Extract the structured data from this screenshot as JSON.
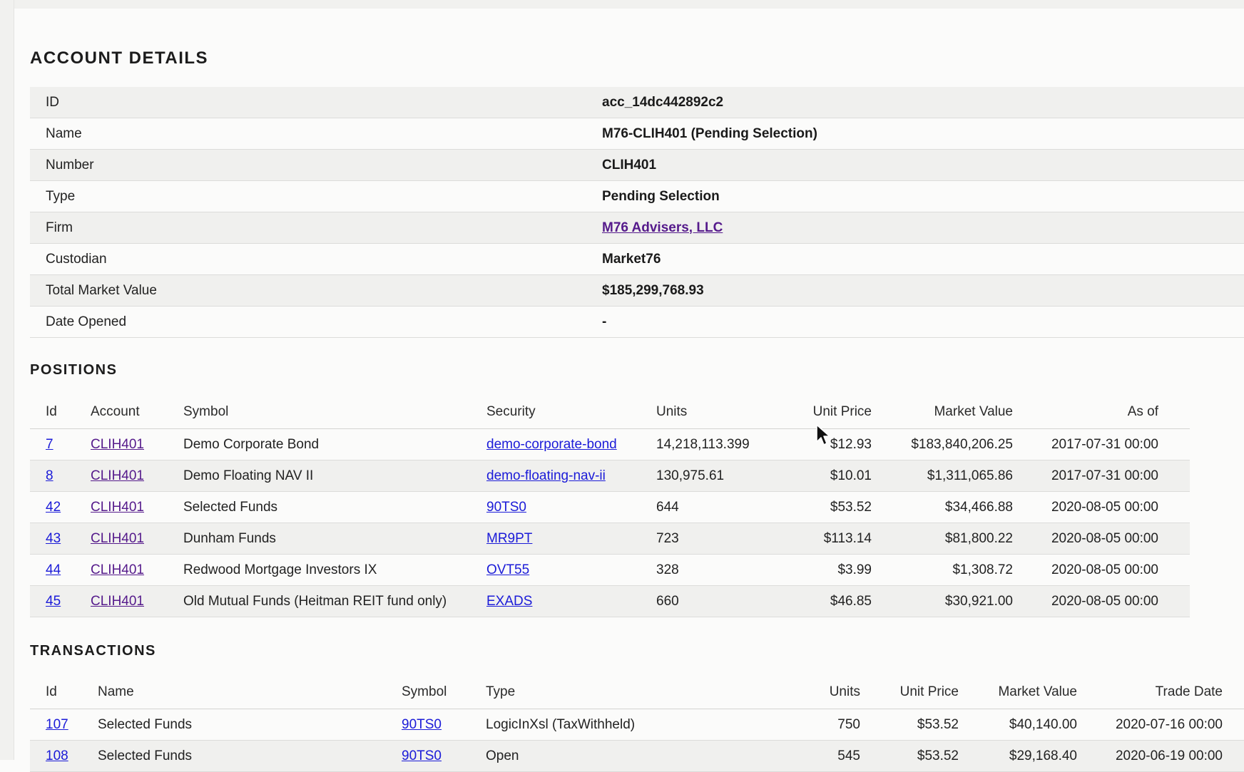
{
  "account_details": {
    "title": "ACCOUNT DETAILS",
    "rows": [
      {
        "label": "ID",
        "value": "acc_14dc442892c2"
      },
      {
        "label": "Name",
        "value": "M76-CLIH401 (Pending Selection)"
      },
      {
        "label": "Number",
        "value": "CLIH401"
      },
      {
        "label": "Type",
        "value": "Pending Selection"
      },
      {
        "label": "Firm",
        "value": "M76 Advisers, LLC"
      },
      {
        "label": "Custodian",
        "value": "Market76"
      },
      {
        "label": "Total Market Value",
        "value": "$185,299,768.93"
      },
      {
        "label": "Date Opened",
        "value": "-"
      }
    ]
  },
  "positions": {
    "title": "POSITIONS",
    "headers": [
      "Id",
      "Account",
      "Symbol",
      "Security",
      "Units",
      "Unit Price",
      "Market Value",
      "As of"
    ],
    "rows": [
      [
        "7",
        "CLIH401",
        "Demo Corporate Bond",
        "demo-corporate-bond",
        "14,218,113.399",
        "$12.93",
        "$183,840,206.25",
        "2017-07-31 00:00"
      ],
      [
        "8",
        "CLIH401",
        "Demo Floating NAV II",
        "demo-floating-nav-ii",
        "130,975.61",
        "$10.01",
        "$1,311,065.86",
        "2017-07-31 00:00"
      ],
      [
        "42",
        "CLIH401",
        "Selected Funds",
        "90TS0",
        "644",
        "$53.52",
        "$34,466.88",
        "2020-08-05 00:00"
      ],
      [
        "43",
        "CLIH401",
        "Dunham Funds",
        "MR9PT",
        "723",
        "$113.14",
        "$81,800.22",
        "2020-08-05 00:00"
      ],
      [
        "44",
        "CLIH401",
        "Redwood Mortgage Investors IX",
        "OVT55",
        "328",
        "$3.99",
        "$1,308.72",
        "2020-08-05 00:00"
      ],
      [
        "45",
        "CLIH401",
        "Old Mutual Funds (Heitman REIT fund only)",
        "EXADS",
        "660",
        "$46.85",
        "$30,921.00",
        "2020-08-05 00:00"
      ]
    ]
  },
  "transactions": {
    "title": "TRANSACTIONS",
    "headers": [
      "Id",
      "Name",
      "Symbol",
      "Type",
      "Units",
      "Unit Price",
      "Market Value",
      "Trade Date"
    ],
    "rows": [
      [
        "107",
        "Selected Funds",
        "90TS0",
        "LogicInXsl (TaxWithheld)",
        "750",
        "$53.52",
        "$40,140.00",
        "2020-07-16 00:00"
      ],
      [
        "108",
        "Selected Funds",
        "90TS0",
        "Open",
        "545",
        "$53.52",
        "$29,168.40",
        "2020-06-19 00:00"
      ]
    ]
  },
  "colors": {
    "link": "#1b1bd8",
    "visited_link": "#551a8b",
    "stripe": "#f0f0ee",
    "background": "#fbfbfa"
  },
  "icons": {
    "cursor": "mouse-pointer-icon"
  }
}
